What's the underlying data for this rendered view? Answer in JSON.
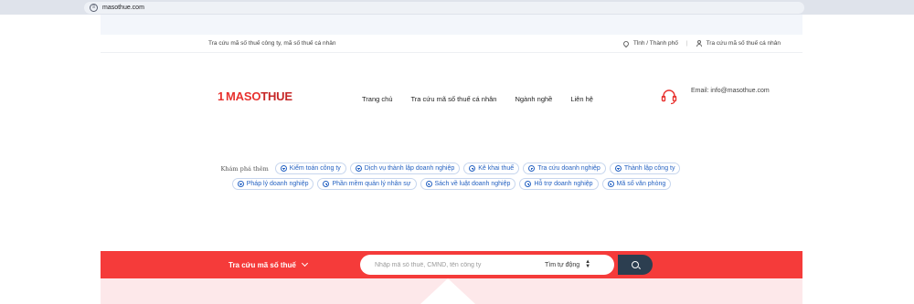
{
  "browser": {
    "url": "masothue.com",
    "site_icon": "tune-icon"
  },
  "topbar": {
    "tagline": "Tra cứu mã số thuế công ty, mã số thuế cá nhân",
    "location_label": "Tỉnh / Thành phố",
    "personal_lookup_label": "Tra cứu mã số thuế cá nhân"
  },
  "header": {
    "logo": {
      "mark": "1",
      "part_a": "MASO",
      "part_b": "THUE"
    },
    "nav": [
      {
        "label": "Trang chủ"
      },
      {
        "label": "Tra cứu mã số thuế cá nhân"
      },
      {
        "label": "Ngành nghề"
      },
      {
        "label": "Liên hệ"
      }
    ],
    "email": "Email: info@masothue.com"
  },
  "explore": {
    "label": "Khám phá thêm",
    "row1": [
      "Kiểm toán công ty",
      "Dịch vụ thành lập doanh nghiệp",
      "Kê khai thuế",
      "Tra cứu doanh nghiệp",
      "Thành lập công ty"
    ],
    "row2": [
      "Pháp lý doanh nghiệp",
      "Phần mềm quản lý nhân sự",
      "Sách về luật doanh nghiệp",
      "Hỗ trợ doanh nghiệp",
      "Mã số văn phòng"
    ]
  },
  "search": {
    "category": "Tra cứu mã số thuế",
    "placeholder": "Nhập mã số thuế, CMND, tên công ty",
    "mode": "Tìm tự động"
  },
  "colors": {
    "brand_red": "#f53b3a",
    "link_blue": "#2562c2",
    "search_button": "#2c3e50"
  }
}
